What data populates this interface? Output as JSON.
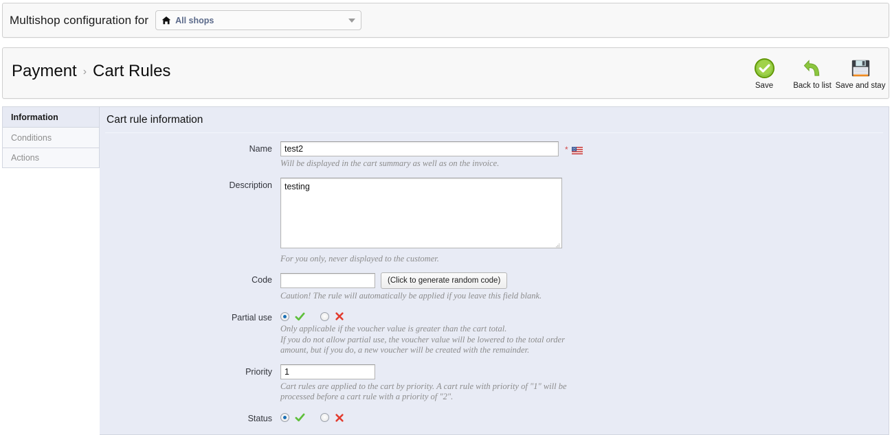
{
  "multishop": {
    "label": "Multishop configuration for",
    "selector": {
      "icon": "home-icon",
      "value": "All shops",
      "caret": "chevron-down-icon"
    }
  },
  "header": {
    "breadcrumb": {
      "parent": "Payment",
      "separator": "›",
      "current": "Cart Rules"
    },
    "toolbar": [
      {
        "id": "save",
        "label": "Save",
        "icon": "green-check-circle-icon"
      },
      {
        "id": "back-to-list",
        "label": "Back to list",
        "icon": "green-back-arrow-icon"
      },
      {
        "id": "save-and-stay",
        "label": "Save and stay",
        "icon": "floppy-disk-icon"
      }
    ]
  },
  "tabs": [
    {
      "id": "information",
      "label": "Information",
      "active": true
    },
    {
      "id": "conditions",
      "label": "Conditions",
      "active": false
    },
    {
      "id": "actions",
      "label": "Actions",
      "active": false
    }
  ],
  "form": {
    "title": "Cart rule information",
    "name": {
      "label": "Name",
      "value": "test2",
      "required_mark": "*",
      "flag": "us-flag-icon",
      "hint": "Will be displayed in the cart summary as well as on the invoice."
    },
    "description": {
      "label": "Description",
      "value": "testing",
      "hint": "For you only, never displayed to the customer."
    },
    "code": {
      "label": "Code",
      "value": "",
      "placeholder": "",
      "generate_button": "(Click to generate random code)",
      "hint": "Caution! The rule will automatically be applied if you leave this field blank."
    },
    "partial_use": {
      "label": "Partial use",
      "yes_selected": true,
      "no_selected": false,
      "yes_icon": "green-check-icon",
      "no_icon": "red-cross-icon",
      "hint_line1": "Only applicable if the voucher value is greater than the cart total.",
      "hint_line2": "If you do not allow partial use, the voucher value will be lowered to the total order",
      "hint_line3": "amount, but if you do, a new voucher will be created with the remainder."
    },
    "priority": {
      "label": "Priority",
      "value": "1",
      "hint_line1": "Cart rules are applied to the cart by priority. A cart rule with priority of \"1\" will be",
      "hint_line2": "processed before a cart rule with a priority of \"2\"."
    },
    "status": {
      "label": "Status",
      "yes_selected": true,
      "no_selected": false,
      "yes_icon": "green-check-icon",
      "no_icon": "red-cross-icon"
    }
  },
  "colors": {
    "panel_bg": "#e8ebf5",
    "header_bg": "#f8f8f8",
    "accent_green": "#7ab800",
    "accent_red": "#e23b2e",
    "radio_blue": "#1a6fb5",
    "required_red": "#d24848"
  }
}
